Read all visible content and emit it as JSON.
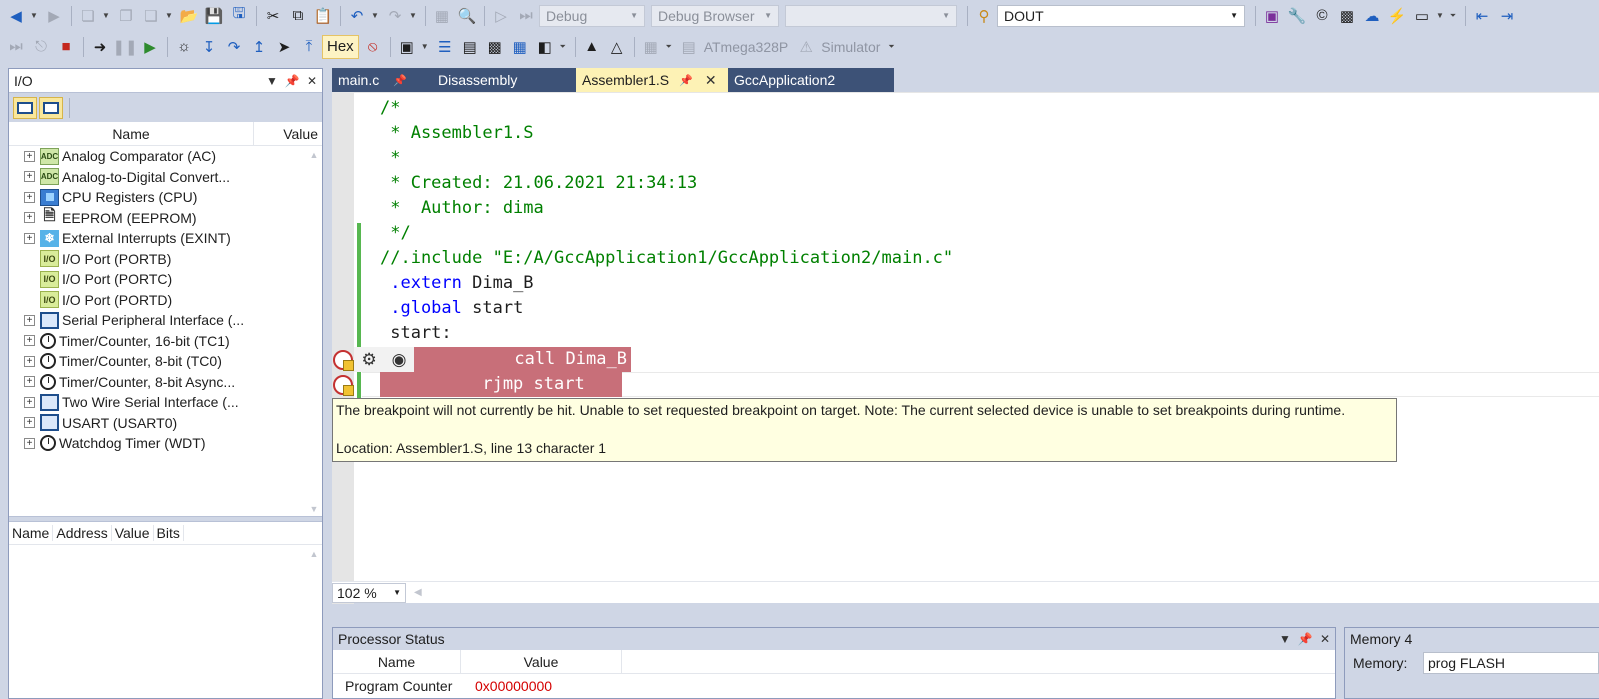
{
  "toolbar_top": {
    "solution_config": "Debug",
    "platform": "Debug Browser",
    "empty_combo": "",
    "find_combo": "DOUT",
    "icons": [
      "back-icon",
      "forward-icon",
      "new-project-icon",
      "add-item-icon",
      "open-icon",
      "save-icon",
      "save-all-icon",
      "cut-icon",
      "copy-icon",
      "paste-icon",
      "undo-icon",
      "redo-icon",
      "start-icon",
      "start-without-debug-icon",
      "find-icon",
      "settings-icon",
      "wrench-icon"
    ]
  },
  "toolbar_debug": {
    "hex_label": "Hex",
    "device_label": "ATmega328P",
    "tool_label": "Simulator"
  },
  "io_panel": {
    "title": "I/O",
    "col_name": "Name",
    "col_value": "Value",
    "items": [
      {
        "label": "Analog Comparator (AC)",
        "icon": "adc",
        "expandable": true
      },
      {
        "label": "Analog-to-Digital Convert...",
        "icon": "adc",
        "expandable": true
      },
      {
        "label": "CPU Registers (CPU)",
        "icon": "cpu",
        "expandable": true
      },
      {
        "label": "EEPROM (EEPROM)",
        "icon": "ee",
        "expandable": true
      },
      {
        "label": "External Interrupts (EXINT)",
        "icon": "ext",
        "expandable": true
      },
      {
        "label": "I/O Port (PORTB)",
        "icon": "port",
        "expandable": false
      },
      {
        "label": "I/O Port (PORTC)",
        "icon": "port",
        "expandable": false
      },
      {
        "label": "I/O Port (PORTD)",
        "icon": "port",
        "expandable": false
      },
      {
        "label": "Serial Peripheral Interface (...",
        "icon": "ser",
        "expandable": true
      },
      {
        "label": "Timer/Counter, 16-bit (TC1)",
        "icon": "tmr",
        "expandable": true
      },
      {
        "label": "Timer/Counter, 8-bit (TC0)",
        "icon": "tmr",
        "expandable": true
      },
      {
        "label": "Timer/Counter, 8-bit Async...",
        "icon": "tmr",
        "expandable": true
      },
      {
        "label": "Two Wire Serial Interface (...",
        "icon": "ser",
        "expandable": true
      },
      {
        "label": "USART (USART0)",
        "icon": "ser",
        "expandable": true
      },
      {
        "label": "Watchdog Timer (WDT)",
        "icon": "tmr",
        "expandable": true
      }
    ],
    "regs_cols": [
      "Name",
      "Address",
      "Value",
      "Bits"
    ]
  },
  "tabs": [
    {
      "label": "main.c",
      "active": false
    },
    {
      "label": "Disassembly",
      "active": false
    },
    {
      "label": "Assembler1.S",
      "active": true
    },
    {
      "label": "GccApplication2",
      "active": false
    }
  ],
  "editor": {
    "lines": [
      "/*",
      " * Assembler1.S",
      " *",
      " * Created: 21.06.2021 21:34:13",
      " *  Author: dima",
      " */",
      "//.include \"E:/A/GccApplication1/GccApplication2/main.c\"",
      " .extern",
      " Dima_B",
      " .global",
      " start",
      " start:",
      "          call Dima_B",
      "          rjmp start"
    ],
    "tooltip_line1": "The breakpoint will not currently be hit. Unable to set requested breakpoint on target. Note: The current selected device is unable to set breakpoints during runtime.",
    "tooltip_line2": "Location: Assembler1.S, line 13 character 1",
    "zoom": "102 %"
  },
  "processor_status": {
    "title": "Processor Status",
    "col_name": "Name",
    "col_value": "Value",
    "row_name": "Program Counter",
    "row_value": "0x00000000"
  },
  "memory_panel": {
    "title": "Memory 4",
    "label": "Memory:",
    "value": "prog FLASH"
  },
  "colors": {
    "breakpoint_highlight": "#c86f79",
    "active_tab": "#fdf2b5",
    "inactive_tab": "#3d5277",
    "comment": "#008000",
    "keyword": "#0000ff"
  }
}
